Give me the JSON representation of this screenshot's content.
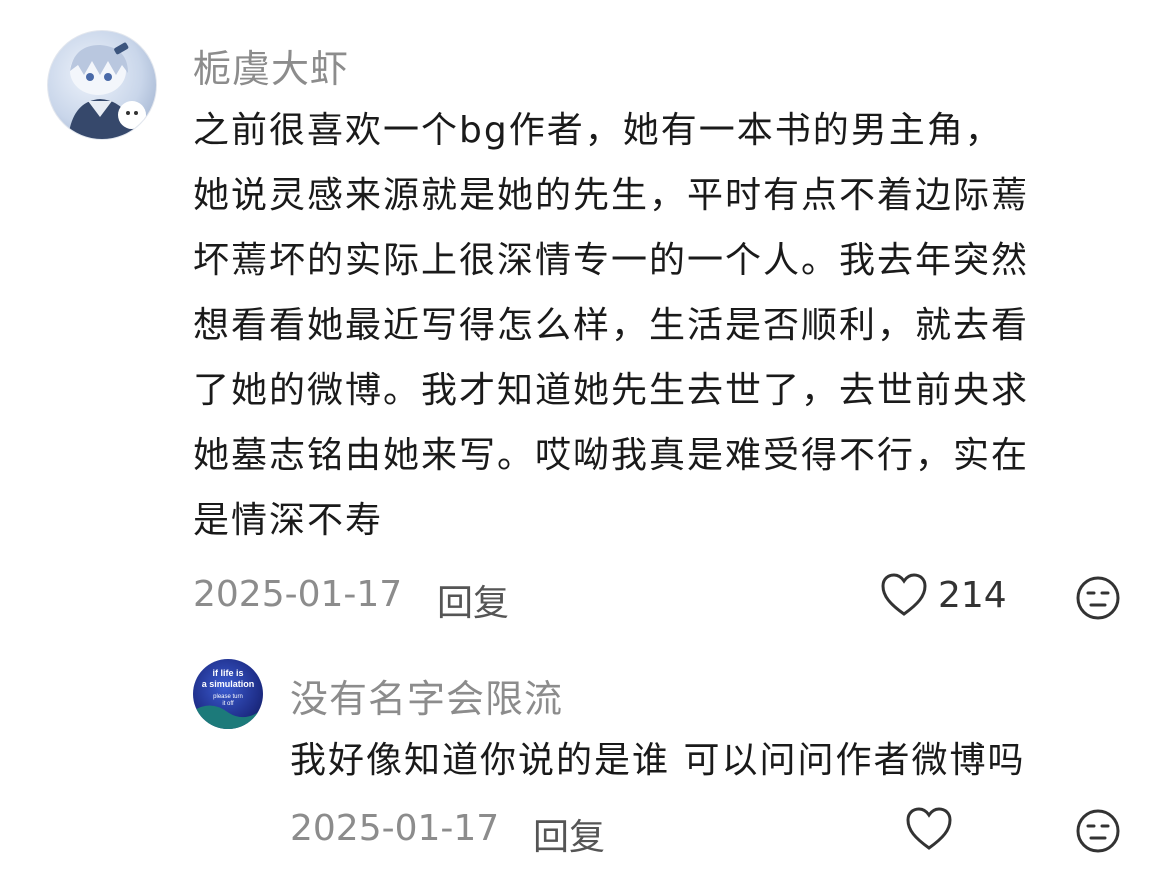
{
  "comment": {
    "username": "栀虞大虾",
    "lines": [
      "之前很喜欢一个bg作者，她有一本书的男主角，",
      "她说灵感来源就是她的先生，平时有点不着边际蔫",
      "坏蔫坏的实际上很深情专一的一个人。我去年突然",
      "想看看她最近写得怎么样，生活是否顺利，就去看",
      "了她的微博。我才知道她先生去世了，去世前央求",
      "她墓志铭由她来写。哎呦我真是难受得不行，实在",
      "是情深不寿"
    ],
    "date": "2025-01-17",
    "reply_label": "回复",
    "like_count": "214",
    "avatar_icon": "anime-character-avatar-icon",
    "like_icon": "heart-outline-icon",
    "dislike_icon": "neutral-face-icon"
  },
  "reply": {
    "username": "没有名字会限流",
    "text": "我好像知道你说的是谁 可以问问作者微博吗",
    "date": "2025-01-17",
    "reply_label": "回复",
    "like_count": "",
    "avatar_icon": "simulation-text-avatar-icon",
    "avatar_text": [
      "if life is",
      "a simulation",
      "please turn",
      "it off"
    ],
    "like_icon": "heart-outline-icon",
    "dislike_icon": "neutral-face-icon"
  }
}
